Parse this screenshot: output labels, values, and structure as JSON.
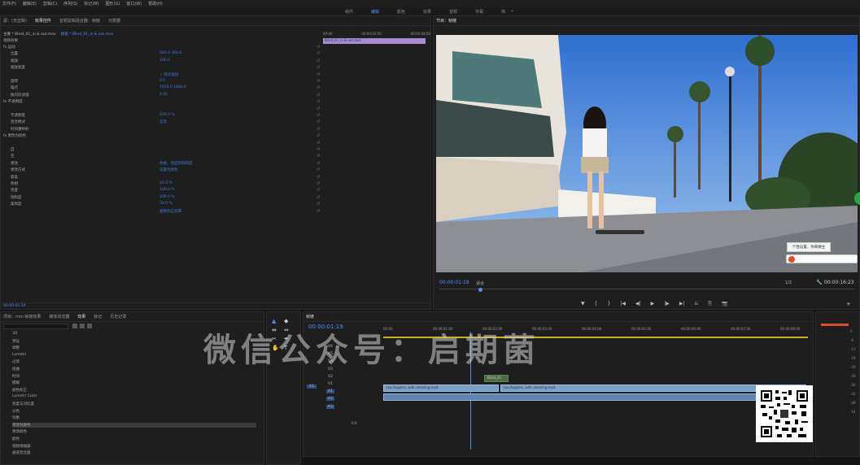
{
  "menubar": [
    "文件(F)",
    "编辑(E)",
    "剪辑(C)",
    "序列(S)",
    "标记(M)",
    "图形(G)",
    "窗口(W)",
    "帮助(H)"
  ],
  "workspaces": {
    "items": [
      "组件",
      "编辑",
      "颜色",
      "效果",
      "音频",
      "字幕",
      "库"
    ],
    "active": "编辑",
    "more": "»"
  },
  "effect_controls": {
    "tabs": [
      "源：(无剪辑)",
      "效果控件",
      "音频剪辑混合器：帧链",
      "元数据"
    ],
    "source_label": "主要 * Blind_01_in & out.mov",
    "seq_label": "帧链 * Blind_01_in & out.mov",
    "clip_name": "Blind_01_in & out.mov",
    "ruler_times": [
      "00:00",
      "00:00:02:00",
      "00:00:04:00"
    ],
    "section": "视频效果",
    "rows": [
      {
        "label": "fx 运动",
        "val": ""
      },
      {
        "label": "位置",
        "val": "540.0    360.0"
      },
      {
        "label": "缩放",
        "val": "100.0"
      },
      {
        "label": "缩放宽度",
        "val": ""
      },
      {
        "label": "",
        "val": "✓ 等比缩放"
      },
      {
        "label": "旋转",
        "val": "0.0"
      },
      {
        "label": "锚点",
        "val": "1920.0    1080.0"
      },
      {
        "label": "防闪烁滤镜",
        "val": "0.00"
      },
      {
        "label": "fx 不透明度",
        "val": ""
      },
      {
        "label": "",
        "val": ""
      },
      {
        "label": "不透明度",
        "val": "100.0 %"
      },
      {
        "label": "混合模式",
        "val": "正常"
      },
      {
        "label": "时间重映射",
        "val": ""
      },
      {
        "label": "fx 更改为颜色",
        "val": ""
      },
      {
        "label": "",
        "val": ""
      },
      {
        "label": "自",
        "val": ""
      },
      {
        "label": "至",
        "val": ""
      },
      {
        "label": "更改",
        "val": "色相、亮度和饱和度"
      },
      {
        "label": "更改方式",
        "val": "设置为颜色"
      },
      {
        "label": "容差",
        "val": ""
      },
      {
        "label": "色相",
        "val": "10.0 %"
      },
      {
        "label": "亮度",
        "val": "100.0 %"
      },
      {
        "label": "饱和度",
        "val": "100.0 %"
      },
      {
        "label": "柔和度",
        "val": "50.0 %"
      },
      {
        "label": "",
        "val": "查看校正遮罩"
      }
    ],
    "timecode": "00:00:01:19"
  },
  "program": {
    "title": "节目：帧链",
    "timecode": "00:00:01:19",
    "fit": "适合",
    "quality": "1/2",
    "duration": "00:00:16:23",
    "tooltip": "个性设置，你来做主"
  },
  "project": {
    "tabs": [
      "项目：mm 帧链效果",
      "媒体浏览器",
      "效果",
      "标记",
      "历史记录"
    ],
    "items": [
      "3D",
      "预设",
      "调整",
      "Lumetri",
      "过渡",
      "扭曲",
      "时间",
      "模糊",
      "颜色校正",
      "Lumetri Color",
      "亮度与对比度",
      "分色",
      "均衡",
      "更改为颜色",
      "更改颜色",
      "颜色",
      "视频限幅器",
      "通道混合器"
    ],
    "selected": "更改为颜色"
  },
  "timeline": {
    "title": "帧链",
    "timecode": "00:00:01:19",
    "ruler": [
      "00:00",
      "00:00:01:00",
      "00:00:02:00",
      "00:00:03:00",
      "00:00:04:00",
      "00:00:05:00",
      "00:00:06:00",
      "00:00:07:00",
      "00:00:08:00"
    ],
    "video_tracks": [
      "V6",
      "V5",
      "V4",
      "V3",
      "V2",
      "V1"
    ],
    "audio_tracks": [
      "A1",
      "A2",
      "A3"
    ],
    "mix_label": "0.0",
    "clip_v2": "Blind_01",
    "clip_v1a": "Los Angeles, with amazing.mp4",
    "clip_v1b": "Los Angeles, with amazing.mp4",
    "tracks_v_label": "V1",
    "audio_meter": [
      "0",
      "-6",
      "-12",
      "-18",
      "-24",
      "-30",
      "-36",
      "-42",
      "-48",
      "-54"
    ]
  },
  "watermark": "微信公众号：启期菌",
  "colors": {
    "accent": "#4d8dff",
    "clip": "#7ba0c8",
    "playhead": "#4d8dff",
    "bg": "#161616"
  }
}
